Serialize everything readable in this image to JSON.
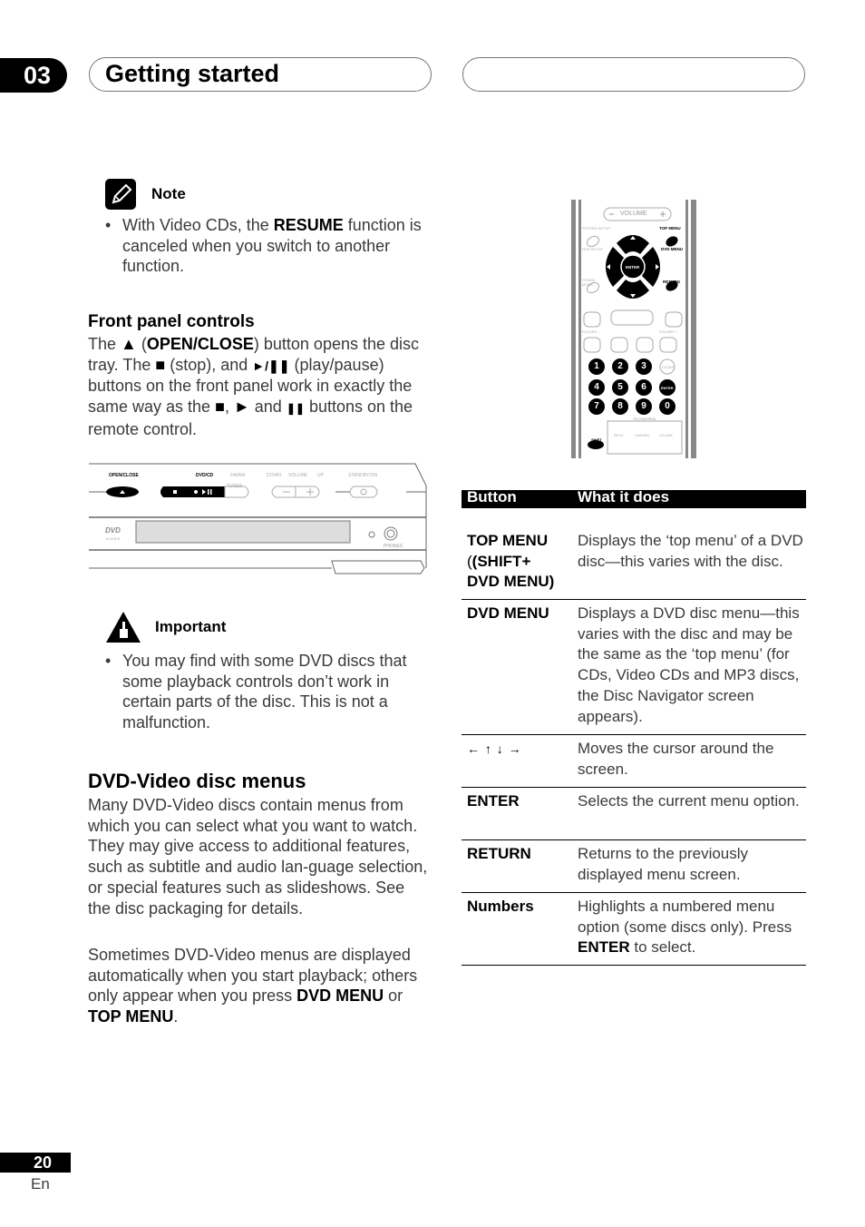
{
  "header": {
    "chapter_number": "03",
    "chapter_title": "Getting started"
  },
  "note": {
    "heading": "Note",
    "bullet_parts": [
      "With Video CDs, the ",
      "RESUME",
      " function is canceled when you switch to another function."
    ]
  },
  "front_panel": {
    "heading": "Front panel controls",
    "para_parts": {
      "p1": "The ",
      "eject_symbol": "▲",
      "p2": " (",
      "open_close": "OPEN/CLOSE",
      "p3": ") button opens the disc tray. The ",
      "stop_symbol": "■",
      "p4": " (stop), and ",
      "playpause_symbol": "►/❚❚",
      "p5": " (play/pause) buttons on the front panel work in exactly the same way as the ",
      "stop_symbol2": "■",
      "p6": ", ",
      "play_symbol": "►",
      "p7": " and ",
      "pause_symbol": "❚❚",
      "p8": " buttons on the remote control."
    },
    "illustration": {
      "labels": {
        "open_close": "OPEN/CLOSE",
        "dvd_cd": "DVD/CD",
        "fm_am": "FM/AM",
        "down": "DOWN",
        "volume": "VOLUME",
        "up": "UP",
        "standby_on": "STANDBY/ON",
        "tuner": "TUNER",
        "phones": "PHONES",
        "dvd_logo": "DVD",
        "video": "VIDEO"
      }
    }
  },
  "important": {
    "heading": "Important",
    "bullet": "You may find with some DVD discs that some playback controls don’t work in certain parts of the disc. This is not a malfunction."
  },
  "dvd_menus": {
    "heading": "DVD-Video disc menus",
    "para1": "Many DVD-Video discs contain menus from which you can select what you want to watch. They may give access to additional features, such as subtitle and audio lan-guage selection, or special features such as slideshows. See the disc packaging for details.",
    "para2_parts": [
      "Sometimes DVD-Video menus are displayed automatically when you start playback; others only appear when you press ",
      "DVD MENU",
      " or ",
      "TOP MENU",
      "."
    ]
  },
  "remote": {
    "labels": {
      "volume": "VOLUME",
      "system_setup": "SYSTEM SETUP",
      "dvd_setup": "DVD SETUP",
      "top_menu": "TOP MENU",
      "dvd_menu": "DVD MENU",
      "enter": "ENTER",
      "return": "RETURN",
      "sound_mode": "SOUND MODE",
      "folder_minus": "FOLDER –",
      "folder_plus": "FOLDER +",
      "clear": "CLEAR",
      "shift": "SHIFT",
      "tv_control": "TV CONTROL",
      "input": "INPUT",
      "channel": "CHANNEL",
      "tv_volume": "VOLUME",
      "enter2": "ENTER"
    },
    "numbers": [
      "1",
      "2",
      "3",
      "4",
      "5",
      "6",
      "7",
      "8",
      "9",
      "0"
    ]
  },
  "table": {
    "headers": [
      "Button",
      "What it does"
    ],
    "rows": [
      {
        "button_lines": [
          "TOP MENU",
          "(SHIFT+",
          "DVD MENU)"
        ],
        "desc": "Displays the ‘top menu’ of a DVD disc—this varies with the disc."
      },
      {
        "button_lines": [
          "DVD MENU"
        ],
        "desc": "Displays a DVD disc menu—this varies with the disc and may be the same as the ‘top menu’ (for CDs, Video CDs and MP3 discs, the Disc Navigator screen appears)."
      },
      {
        "button_lines": [
          "← ↑ ↓ →"
        ],
        "desc": "Moves the cursor around the screen."
      },
      {
        "button_lines": [
          "ENTER"
        ],
        "desc": "Selects the current menu option."
      },
      {
        "button_lines": [
          "RETURN"
        ],
        "desc": "Returns to the previously displayed menu screen."
      },
      {
        "button_lines": [
          "Numbers"
        ],
        "desc_parts": [
          "Highlights a numbered menu option (some discs only). Press ",
          "ENTER",
          " to select."
        ]
      }
    ]
  },
  "footer": {
    "page_number": "20",
    "language": "En"
  }
}
